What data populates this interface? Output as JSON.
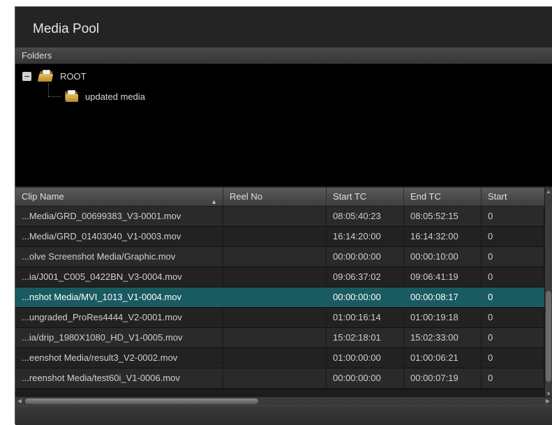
{
  "panel": {
    "title": "Media Pool"
  },
  "folders": {
    "header": "Folders",
    "tree": [
      {
        "label": "ROOT"
      },
      {
        "label": "updated media"
      }
    ]
  },
  "clips": {
    "columns": [
      "Clip Name",
      "Reel No",
      "Start TC",
      "End TC",
      "Start"
    ],
    "sorted_column": "Clip Name",
    "sort_direction": "ascending",
    "selected_index": 4,
    "rows": [
      {
        "name": "...Media/GRD_00699383_V3-0001.mov",
        "reel": "",
        "start_tc": "08:05:40:23",
        "end_tc": "08:05:52:15",
        "start": "0"
      },
      {
        "name": "...Media/GRD_01403040_V1-0003.mov",
        "reel": "",
        "start_tc": "16:14:20:00",
        "end_tc": "16:14:32:00",
        "start": "0"
      },
      {
        "name": "...olve Screenshot Media/Graphic.mov",
        "reel": "",
        "start_tc": "00:00:00:00",
        "end_tc": "00:00:10:00",
        "start": "0"
      },
      {
        "name": "...ia/J001_C005_0422BN_V3-0004.mov",
        "reel": "",
        "start_tc": "09:06:37:02",
        "end_tc": "09:06:41:19",
        "start": "0"
      },
      {
        "name": "...nshot Media/MVI_1013_V1-0004.mov",
        "reel": "",
        "start_tc": "00:00:00:00",
        "end_tc": "00:00:08:17",
        "start": "0"
      },
      {
        "name": "...ungraded_ProRes4444_V2-0001.mov",
        "reel": "",
        "start_tc": "01:00:16:14",
        "end_tc": "01:00:19:18",
        "start": "0"
      },
      {
        "name": "...ia/drip_1980X1080_HD_V1-0005.mov",
        "reel": "",
        "start_tc": "15:02:18:01",
        "end_tc": "15:02:33:00",
        "start": "0"
      },
      {
        "name": "...eenshot Media/result3_V2-0002.mov",
        "reel": "",
        "start_tc": "01:00:00:00",
        "end_tc": "01:00:06:21",
        "start": "0"
      },
      {
        "name": "...reenshot Media/test60i_V1-0006.mov",
        "reel": "",
        "start_tc": "00:00:00:00",
        "end_tc": "00:00:07:19",
        "start": "0"
      }
    ]
  },
  "colors": {
    "selection": "#1a5b62",
    "panel_bg": "#252525",
    "tree_bg": "#000000"
  },
  "icons": [
    "collapse-icon",
    "folder-open-icon",
    "folder-icon",
    "sort-ascending-icon"
  ]
}
